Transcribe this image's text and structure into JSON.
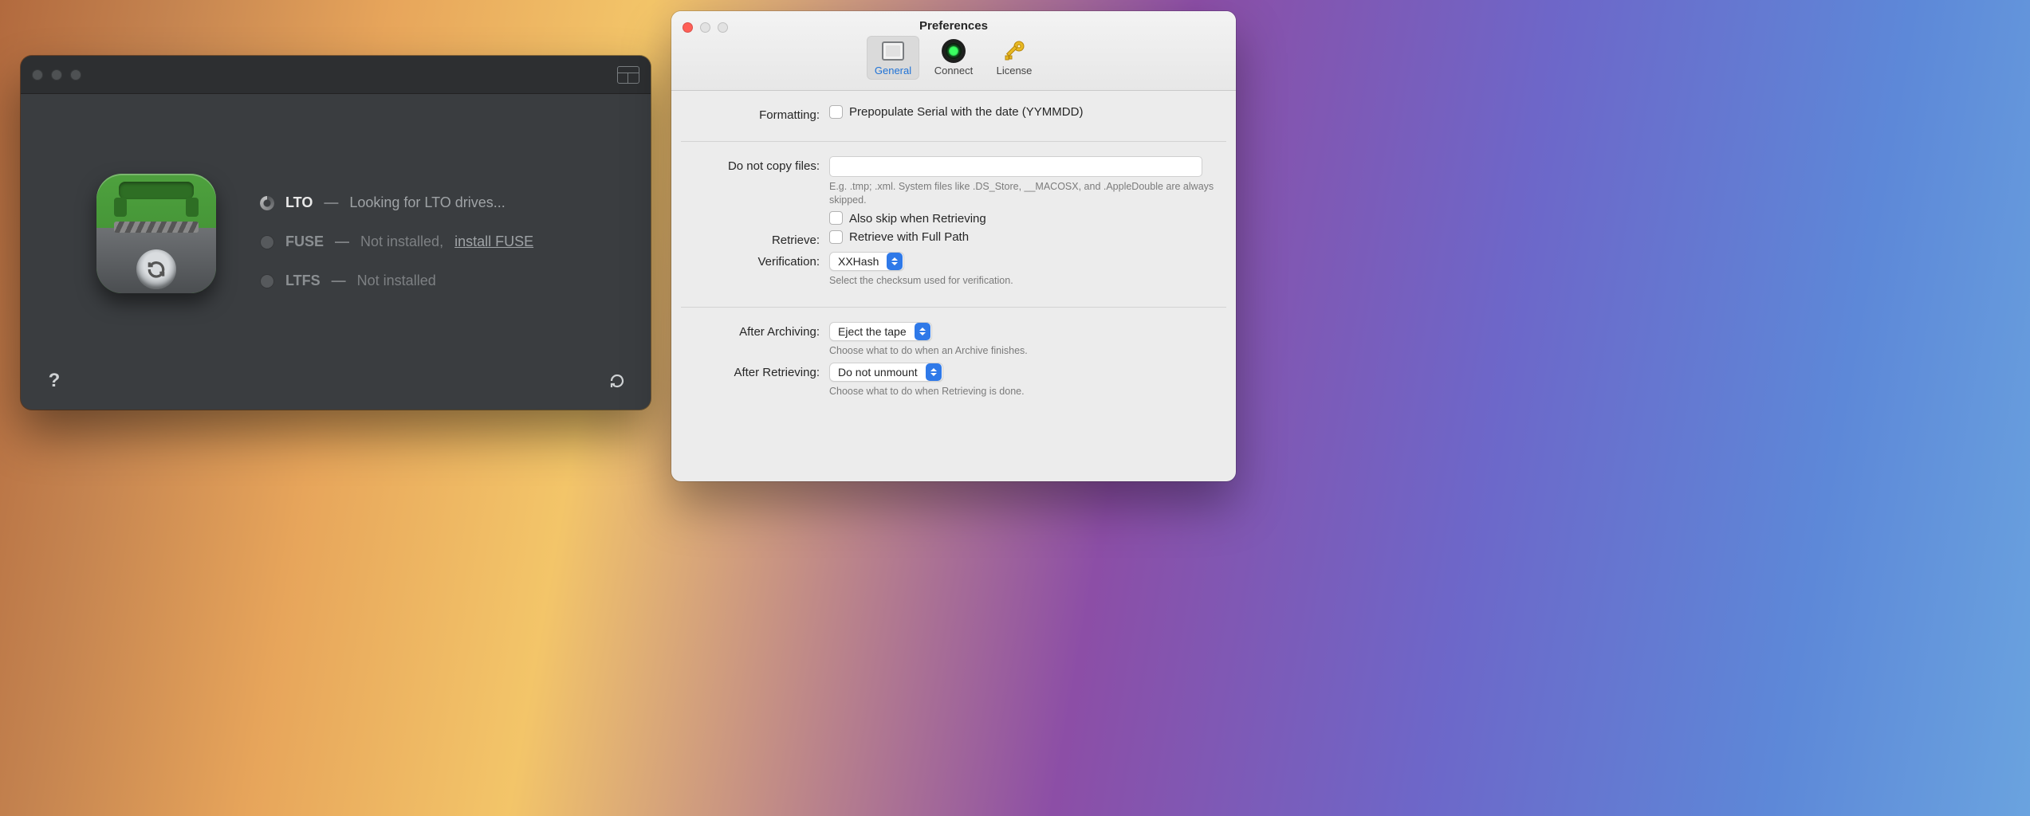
{
  "mainWindow": {
    "status": {
      "lto": {
        "name": "LTO",
        "dash": "—",
        "text": "Looking for LTO drives..."
      },
      "fuse": {
        "name": "FUSE",
        "dash": "—",
        "text": "Not installed,",
        "link": "install FUSE"
      },
      "ltfs": {
        "name": "LTFS",
        "dash": "—",
        "text": "Not installed"
      }
    },
    "help": "?"
  },
  "prefs": {
    "title": "Preferences",
    "tabs": {
      "general": "General",
      "connect": "Connect",
      "license": "License"
    },
    "formatting": {
      "label": "Formatting:",
      "checkbox_label": "Prepopulate Serial with the date (YYMMDD)"
    },
    "doNotCopy": {
      "label": "Do not copy files:",
      "value": "",
      "hint": "E.g. .tmp; .xml. System files like .DS_Store, __MACOSX, and .AppleDouble are always skipped.",
      "also_skip": "Also skip when Retrieving"
    },
    "retrieve": {
      "label": "Retrieve:",
      "checkbox_label": "Retrieve with Full Path"
    },
    "verification": {
      "label": "Verification:",
      "value": "XXHash",
      "hint": "Select the checksum used for verification."
    },
    "afterArchiving": {
      "label": "After Archiving:",
      "value": "Eject the tape",
      "hint": "Choose what to do when an Archive finishes."
    },
    "afterRetrieving": {
      "label": "After Retrieving:",
      "value": "Do not unmount",
      "hint": "Choose what to do when Retrieving is done."
    }
  }
}
